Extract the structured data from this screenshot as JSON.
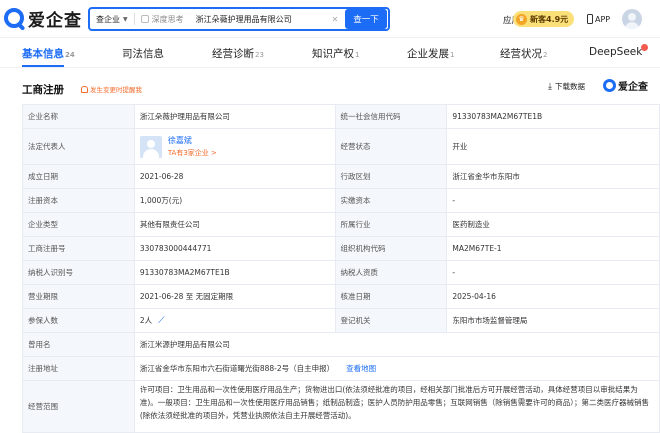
{
  "topbar": {
    "logo_text": "爱企查",
    "search_scope": "查企业",
    "deep_think_label": "深度思考",
    "search_value": "浙江朵薇护理用品有限公司",
    "search_button": "查一下",
    "apply_label": "应用",
    "vip_label": "新客4.9元",
    "app_label": "APP"
  },
  "tabs": [
    {
      "label": "基本信息",
      "count": "24"
    },
    {
      "label": "司法信息",
      "count": ""
    },
    {
      "label": "经营诊断",
      "count": "23"
    },
    {
      "label": "知识产权",
      "count": "1"
    },
    {
      "label": "企业发展",
      "count": "1"
    },
    {
      "label": "经营状况",
      "count": "2"
    },
    {
      "label": "DeepSeek",
      "count": ""
    }
  ],
  "section": {
    "title": "工商注册",
    "notify": "发生变更时提醒我",
    "download": "下载数据",
    "brand": "爱企查"
  },
  "info": {
    "r1": {
      "l1": "企业名称",
      "v1": "浙江朵薇护理用品有限公司",
      "l2": "统一社会信用代码",
      "v2": "91330783MA2M67TE1B"
    },
    "r2": {
      "l1": "法定代表人",
      "rep_name": "徐嘉斌",
      "rep_sub": "TA有3家企业 >",
      "l2": "经营状态",
      "v2": "开业"
    },
    "r3": {
      "l1": "成立日期",
      "v1": "2021-06-28",
      "l2": "行政区划",
      "v2": "浙江省金华市东阳市"
    },
    "r4": {
      "l1": "注册资本",
      "v1": "1,000万(元)",
      "l2": "实缴资本",
      "v2": "-"
    },
    "r5": {
      "l1": "企业类型",
      "v1": "其他有限责任公司",
      "l2": "所属行业",
      "v2": "医药制造业"
    },
    "r6": {
      "l1": "工商注册号",
      "v1": "330783000444771",
      "l2": "组织机构代码",
      "v2": "MA2M67TE-1"
    },
    "r7": {
      "l1": "纳税人识别号",
      "v1": "91330783MA2M67TE1B",
      "l2": "纳税人资质",
      "v2": "-"
    },
    "r8": {
      "l1": "营业期限",
      "v1": "2021-06-28 至 无固定期限",
      "l2": "核准日期",
      "v2": "2025-04-16"
    },
    "r9": {
      "l1": "参保人数",
      "v1": "2人",
      "l2": "登记机关",
      "v2": "东阳市市场监督管理局"
    },
    "r10": {
      "l1": "曾用名",
      "v1": "浙江米源护理用品有限公司"
    },
    "r11": {
      "l1": "注册地址",
      "v1": "浙江省金华市东阳市六石街道曙光街888-2号（自主申报）",
      "link": "查看地图"
    },
    "r12": {
      "l1": "经营范围",
      "v1": "许可项目：卫生用品和一次性使用医疗用品生产；货物进出口(依法须经批准的项目，经相关部门批准后方可开展经营活动，具体经营项目以审批结果为准)。一般项目：卫生用品和一次性使用医疗用品销售；纸制品制造；医护人员防护用品零售；互联网销售（除销售需要许可的商品）；第二类医疗器械销售(除依法须经批准的项目外，凭营业执照依法自主开展经营活动)。"
    }
  },
  "colors": {
    "accent": "#1c6cf5",
    "warn": "#f26c2c",
    "label_bg": "#f4f7fb"
  }
}
